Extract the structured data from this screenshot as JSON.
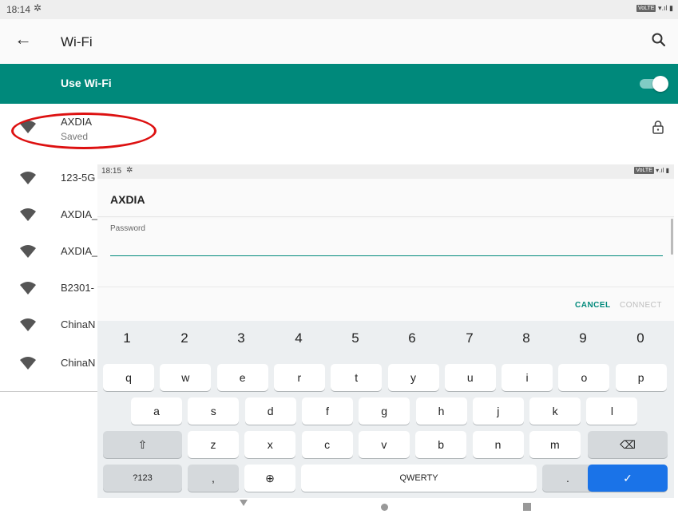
{
  "status_bar": {
    "time": "18:14",
    "volte": "VoLTE"
  },
  "toolbar": {
    "title": "Wi-Fi"
  },
  "use_wifi": {
    "label": "Use Wi-Fi",
    "enabled": true
  },
  "networks": [
    {
      "name": "AXDIA",
      "subtitle": "Saved",
      "locked": true
    },
    {
      "name": "123-5G"
    },
    {
      "name": "AXDIA_"
    },
    {
      "name": "AXDIA_"
    },
    {
      "name": "B2301-"
    },
    {
      "name": "ChinaN"
    },
    {
      "name": "ChinaN"
    }
  ],
  "dialog_status_bar": {
    "time": "18:15",
    "volte": "VoLTE"
  },
  "dialog": {
    "title": "AXDIA",
    "password_label": "Password",
    "password_value": "",
    "cancel_label": "CANCEL",
    "connect_label": "CONNECT"
  },
  "keyboard": {
    "numbers": [
      "1",
      "2",
      "3",
      "4",
      "5",
      "6",
      "7",
      "8",
      "9",
      "0"
    ],
    "row1": [
      "q",
      "w",
      "e",
      "r",
      "t",
      "y",
      "u",
      "i",
      "o",
      "p"
    ],
    "row2": [
      "a",
      "s",
      "d",
      "f",
      "g",
      "h",
      "j",
      "k",
      "l"
    ],
    "row3": [
      "z",
      "x",
      "c",
      "v",
      "b",
      "n",
      "m"
    ],
    "symbols_label": "?123",
    "comma": ",",
    "space_label": "QWERTY",
    "period": "."
  },
  "colors": {
    "accent": "#00897b",
    "enter_key": "#1a73e8",
    "highlight": "#dd1111"
  },
  "icons": {
    "back": "arrow-left-icon",
    "search": "search-icon",
    "wifi": "wifi-icon",
    "lock": "lock-icon",
    "shift": "shift-icon",
    "backspace": "backspace-icon",
    "globe": "globe-icon",
    "enter": "check-icon"
  }
}
